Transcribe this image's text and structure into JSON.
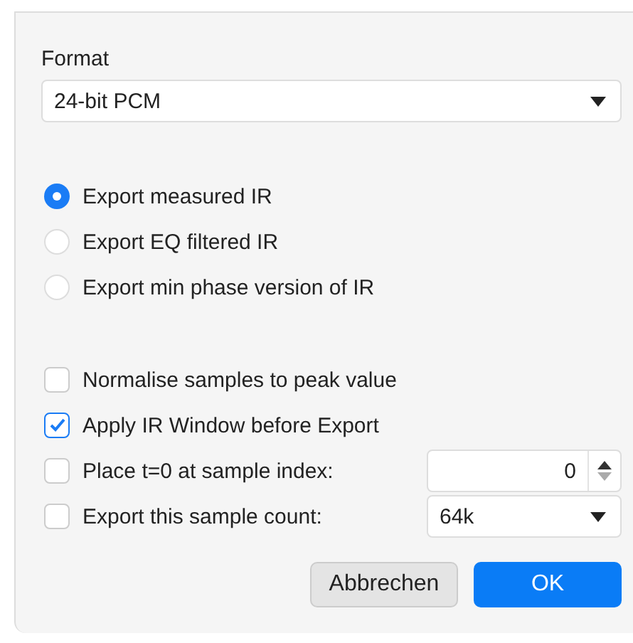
{
  "format": {
    "label": "Format",
    "value": "24-bit PCM"
  },
  "export_options": [
    {
      "label": "Export measured IR",
      "selected": true
    },
    {
      "label": "Export EQ filtered IR",
      "selected": false
    },
    {
      "label": "Export min phase version of IR",
      "selected": false
    }
  ],
  "settings": [
    {
      "kind": "checkbox",
      "label": "Normalise samples to peak value",
      "checked": false
    },
    {
      "kind": "checkbox",
      "label": "Apply IR Window before Export",
      "checked": true
    },
    {
      "kind": "spinner",
      "label": "Place t=0 at sample index:",
      "checked": false,
      "value": "0"
    },
    {
      "kind": "dropdown",
      "label": "Export this sample count:",
      "checked": false,
      "value": "64k"
    }
  ],
  "buttons": [
    {
      "label": "Abbrechen",
      "kind": "secondary"
    },
    {
      "label": "OK",
      "kind": "primary"
    }
  ]
}
